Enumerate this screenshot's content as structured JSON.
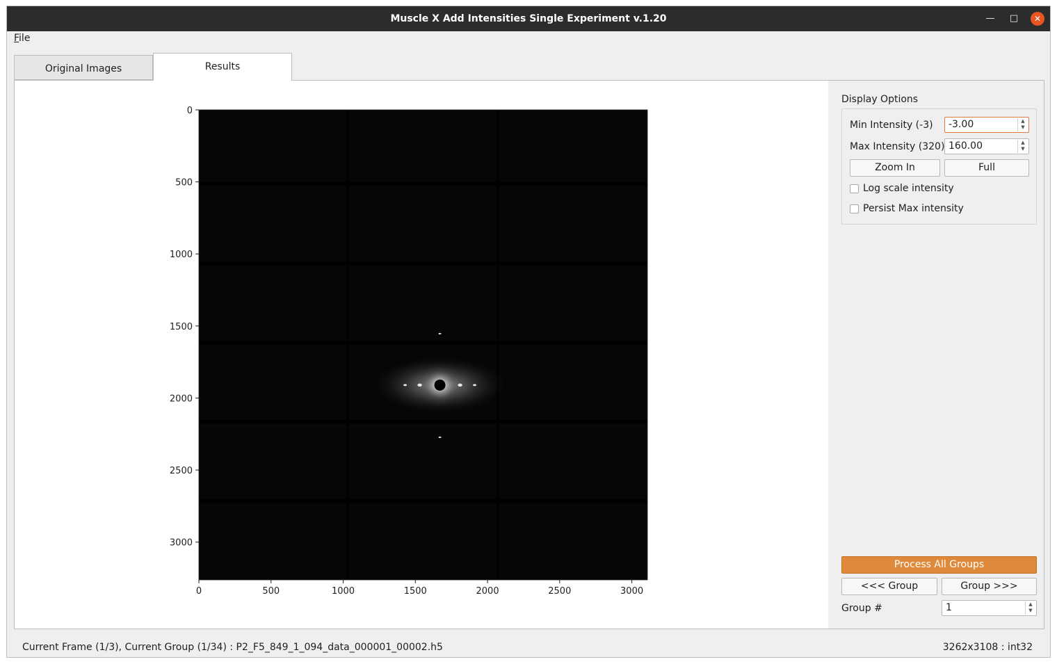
{
  "window": {
    "title": "Muscle X Add Intensities Single Experiment v.1.20",
    "min_icon": "minimize-icon",
    "max_icon": "maximize-icon",
    "close_icon": "close-icon"
  },
  "menu": {
    "file": "File"
  },
  "tabs": [
    {
      "label": "Original Images",
      "active": false
    },
    {
      "label": "Results",
      "active": true
    }
  ],
  "chart_data": {
    "type": "heatmap",
    "x_ticks": [
      0,
      500,
      1000,
      1500,
      2000,
      2500,
      3000
    ],
    "y_ticks": [
      0,
      500,
      1000,
      1500,
      2000,
      2500,
      3000
    ],
    "xlim": [
      0,
      3108
    ],
    "ylim": [
      3262,
      0
    ],
    "grid": false,
    "colormap": "gray",
    "background_color": "#060606",
    "detector_gaps_x": [
      1030,
      2070
    ],
    "detector_gaps_y": [
      514,
      1065,
      1617,
      2165,
      2715
    ],
    "beam_center": [
      1670,
      1910
    ]
  },
  "display_options": {
    "title": "Display Options",
    "min_intensity_label": "Min Intensity (-3)",
    "min_intensity_value": "-3.00",
    "max_intensity_label": "Max Intensity (320)",
    "max_intensity_value": "160.00",
    "zoom_in": "Zoom In",
    "full": "Full",
    "log_scale": "Log scale intensity",
    "log_scale_checked": false,
    "persist_max": "Persist Max intensity",
    "persist_max_checked": false
  },
  "actions": {
    "process_all": "Process All Groups",
    "prev_group": "<<< Group",
    "next_group": "Group >>>",
    "group_label": "Group #",
    "group_value": "1"
  },
  "status": {
    "left": "Current Frame (1/3), Current Group (1/34) : P2_F5_849_1_094_data_000001_00002.h5",
    "right": "3262x3108 : int32"
  },
  "colors": {
    "accent": "#de8a3a",
    "titlebar": "#2c2c2c",
    "close": "#e95420"
  }
}
